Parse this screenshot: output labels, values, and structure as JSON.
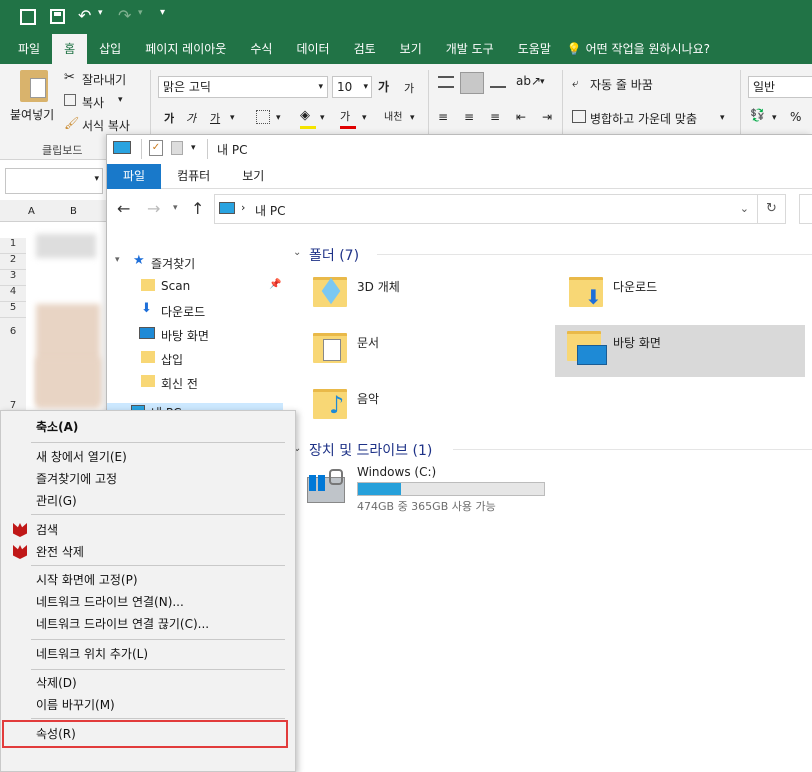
{
  "excel": {
    "tabs": [
      "파일",
      "홈",
      "삽입",
      "페이지 레이아웃",
      "수식",
      "데이터",
      "검토",
      "보기",
      "개발 도구",
      "도움말"
    ],
    "tell_me": "어떤 작업을 원하시나요?",
    "clipboard": {
      "paste": "붙여넣기",
      "cut": "잘라내기",
      "copy": "복사",
      "format_painter": "서식 복사",
      "group": "클립보드"
    },
    "font": {
      "name": "맑은 고딕",
      "size": "10"
    },
    "alignment": {
      "wrap": "자동 줄 바꿈",
      "merge": "병합하고 가운데 맞춤"
    },
    "number_format": "일반",
    "columns": [
      "A",
      "B"
    ],
    "rows": [
      "1",
      "2",
      "3",
      "4",
      "5",
      "6",
      "7"
    ]
  },
  "explorer": {
    "title": "내 PC",
    "tabs": [
      "파일",
      "컴퓨터",
      "보기"
    ],
    "address": "내 PC",
    "nav": {
      "quick_access": "즐겨찾기",
      "items": [
        "Scan",
        "다운로드",
        "바탕 화면",
        "삽입",
        "회신 전"
      ],
      "this_pc": "내 PC"
    },
    "folders_title": "폴더 (7)",
    "folders": [
      "3D 개체",
      "다운로드",
      "문서",
      "바탕 화면",
      "음악"
    ],
    "drives_title": "장치 및 드라이브 (1)",
    "drive": {
      "name": "Windows (C:)",
      "space": "474GB 중 365GB 사용 가능",
      "used_fraction": 0.23
    }
  },
  "context_menu": {
    "items": [
      "축소(A)",
      "새 창에서 열기(E)",
      "즐겨찾기에 고정",
      "관리(G)",
      "검색",
      "완전 삭제",
      "시작 화면에 고정(P)",
      "네트워크 드라이브 연결(N)...",
      "네트워크 드라이브 연결 끊기(C)...",
      "네트워크 위치 추가(L)",
      "삭제(D)",
      "이름 바꾸기(M)",
      "속성(R)"
    ]
  },
  "colors": {
    "excel_green": "#217346",
    "explorer_file_tab": "#1979ca",
    "drive_bar": "#26a0da",
    "highlight": "#e23c3c"
  }
}
